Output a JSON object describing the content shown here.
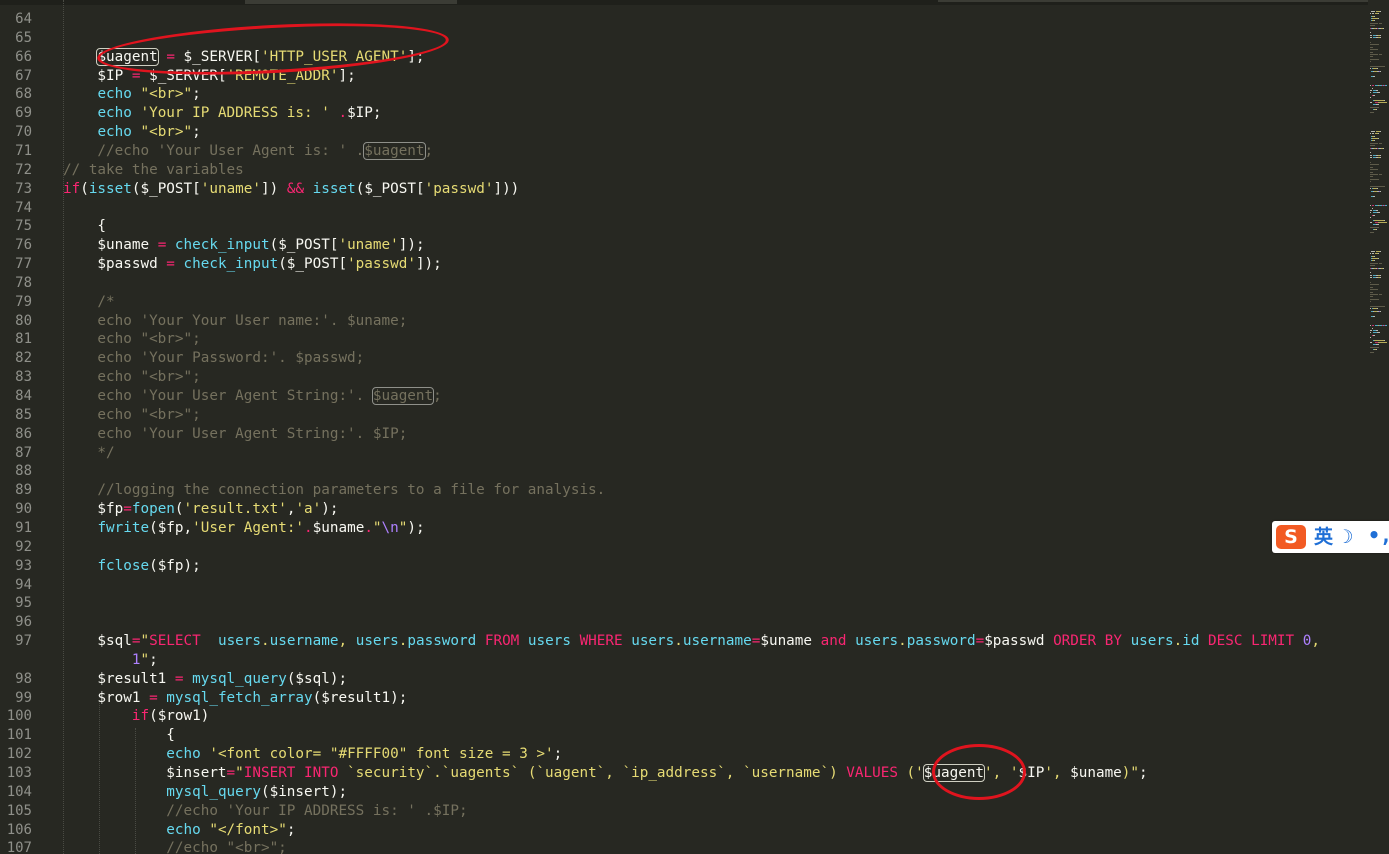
{
  "editor": {
    "theme": "monokai",
    "lines": [
      {
        "n": "64",
        "toks": []
      },
      {
        "n": "65",
        "toks": []
      },
      {
        "n": "66",
        "toks": [
          [
            "    ",
            "plain"
          ],
          [
            "$uagent",
            "hl"
          ],
          [
            " ",
            "plain"
          ],
          [
            "=",
            "kw"
          ],
          [
            " $_SERVER[",
            "plain"
          ],
          [
            "'HTTP_USER_AGENT'",
            "str"
          ],
          [
            "];",
            "plain"
          ]
        ]
      },
      {
        "n": "67",
        "toks": [
          [
            "    $IP ",
            "plain"
          ],
          [
            "=",
            "kw"
          ],
          [
            " $_SERVER[",
            "plain"
          ],
          [
            "'REMOTE_ADDR'",
            "str"
          ],
          [
            "];",
            "plain"
          ]
        ]
      },
      {
        "n": "68",
        "toks": [
          [
            "    ",
            "plain"
          ],
          [
            "echo",
            "fn"
          ],
          [
            " ",
            "plain"
          ],
          [
            "\"<br>\"",
            "str"
          ],
          [
            ";",
            "plain"
          ]
        ]
      },
      {
        "n": "69",
        "toks": [
          [
            "    ",
            "plain"
          ],
          [
            "echo",
            "fn"
          ],
          [
            " ",
            "plain"
          ],
          [
            "'Your IP ADDRESS is: '",
            "str"
          ],
          [
            " ",
            "plain"
          ],
          [
            ".",
            "kw"
          ],
          [
            "$IP;",
            "plain"
          ]
        ]
      },
      {
        "n": "70",
        "toks": [
          [
            "    ",
            "plain"
          ],
          [
            "echo",
            "fn"
          ],
          [
            " ",
            "plain"
          ],
          [
            "\"<br>\"",
            "str"
          ],
          [
            ";",
            "plain"
          ]
        ]
      },
      {
        "n": "71",
        "toks": [
          [
            "    //echo 'Your User Agent is: ' .",
            "cm"
          ],
          [
            "$uagent",
            "hlc"
          ],
          [
            ";",
            "cm"
          ]
        ]
      },
      {
        "n": "72",
        "toks": [
          [
            "// take the variables",
            "cm"
          ]
        ]
      },
      {
        "n": "73",
        "toks": [
          [
            "if",
            "kw"
          ],
          [
            "(",
            "plain"
          ],
          [
            "isset",
            "fn"
          ],
          [
            "($_POST[",
            "plain"
          ],
          [
            "'uname'",
            "str"
          ],
          [
            "]) ",
            "plain"
          ],
          [
            "&&",
            "kw"
          ],
          [
            " ",
            "plain"
          ],
          [
            "isset",
            "fn"
          ],
          [
            "($_POST[",
            "plain"
          ],
          [
            "'passwd'",
            "str"
          ],
          [
            "]))",
            "plain"
          ]
        ]
      },
      {
        "n": "74",
        "toks": []
      },
      {
        "n": "75",
        "toks": [
          [
            "    {",
            "plain"
          ]
        ]
      },
      {
        "n": "76",
        "toks": [
          [
            "    $uname ",
            "plain"
          ],
          [
            "=",
            "kw"
          ],
          [
            " ",
            "plain"
          ],
          [
            "check_input",
            "fn"
          ],
          [
            "($_POST[",
            "plain"
          ],
          [
            "'uname'",
            "str"
          ],
          [
            "]);",
            "plain"
          ]
        ]
      },
      {
        "n": "77",
        "toks": [
          [
            "    $passwd ",
            "plain"
          ],
          [
            "=",
            "kw"
          ],
          [
            " ",
            "plain"
          ],
          [
            "check_input",
            "fn"
          ],
          [
            "($_POST[",
            "plain"
          ],
          [
            "'passwd'",
            "str"
          ],
          [
            "]);",
            "plain"
          ]
        ]
      },
      {
        "n": "78",
        "toks": []
      },
      {
        "n": "79",
        "toks": [
          [
            "    /*",
            "cm"
          ]
        ]
      },
      {
        "n": "80",
        "toks": [
          [
            "    echo 'Your Your User name:'. $uname;",
            "cm"
          ]
        ]
      },
      {
        "n": "81",
        "toks": [
          [
            "    echo \"<br>\";",
            "cm"
          ]
        ]
      },
      {
        "n": "82",
        "toks": [
          [
            "    echo 'Your Password:'. $passwd;",
            "cm"
          ]
        ]
      },
      {
        "n": "83",
        "toks": [
          [
            "    echo \"<br>\";",
            "cm"
          ]
        ]
      },
      {
        "n": "84",
        "toks": [
          [
            "    echo 'Your User Agent String:'. ",
            "cm"
          ],
          [
            "$uagent",
            "hlc"
          ],
          [
            ";",
            "cm"
          ]
        ]
      },
      {
        "n": "85",
        "toks": [
          [
            "    echo \"<br>\";",
            "cm"
          ]
        ]
      },
      {
        "n": "86",
        "toks": [
          [
            "    echo 'Your User Agent String:'. $IP;",
            "cm"
          ]
        ]
      },
      {
        "n": "87",
        "toks": [
          [
            "    */",
            "cm"
          ]
        ]
      },
      {
        "n": "88",
        "toks": []
      },
      {
        "n": "89",
        "toks": [
          [
            "    //logging the connection parameters to a file for analysis.",
            "cm"
          ]
        ]
      },
      {
        "n": "90",
        "toks": [
          [
            "    $fp",
            "plain"
          ],
          [
            "=",
            "kw"
          ],
          [
            "fopen",
            "fn"
          ],
          [
            "(",
            "plain"
          ],
          [
            "'result.txt'",
            "str"
          ],
          [
            ",",
            "plain"
          ],
          [
            "'a'",
            "str"
          ],
          [
            ");",
            "plain"
          ]
        ]
      },
      {
        "n": "91",
        "toks": [
          [
            "    ",
            "plain"
          ],
          [
            "fwrite",
            "fn"
          ],
          [
            "($fp,",
            "plain"
          ],
          [
            "'User Agent:'",
            "str"
          ],
          [
            ".",
            "kw"
          ],
          [
            "$uname",
            "plain"
          ],
          [
            ".",
            "kw"
          ],
          [
            "\"",
            "str"
          ],
          [
            "\\n",
            "esc"
          ],
          [
            "\"",
            "str"
          ],
          [
            ");",
            "plain"
          ]
        ]
      },
      {
        "n": "92",
        "toks": []
      },
      {
        "n": "93",
        "toks": [
          [
            "    ",
            "plain"
          ],
          [
            "fclose",
            "fn"
          ],
          [
            "($fp);",
            "plain"
          ]
        ]
      },
      {
        "n": "94",
        "toks": []
      },
      {
        "n": "95",
        "toks": []
      },
      {
        "n": "96",
        "toks": []
      },
      {
        "n": "97",
        "toks": [
          [
            "    $sql",
            "plain"
          ],
          [
            "=",
            "kw"
          ],
          [
            "\"",
            "str"
          ],
          [
            "SELECT",
            "sqlkw"
          ],
          [
            "  ",
            "str"
          ],
          [
            "users",
            "sqlid"
          ],
          [
            ".",
            "str"
          ],
          [
            "username",
            "sqlid"
          ],
          [
            ", ",
            "str"
          ],
          [
            "users",
            "sqlid"
          ],
          [
            ".",
            "str"
          ],
          [
            "password",
            "sqlid"
          ],
          [
            " ",
            "str"
          ],
          [
            "FROM",
            "sqlkw"
          ],
          [
            " ",
            "str"
          ],
          [
            "users",
            "sqlid"
          ],
          [
            " ",
            "str"
          ],
          [
            "WHERE",
            "sqlkw"
          ],
          [
            " ",
            "str"
          ],
          [
            "users",
            "sqlid"
          ],
          [
            ".",
            "str"
          ],
          [
            "username",
            "sqlid"
          ],
          [
            "=",
            "kw"
          ],
          [
            "$uname",
            "plain"
          ],
          [
            " ",
            "str"
          ],
          [
            "and",
            "sqlkw"
          ],
          [
            " ",
            "str"
          ],
          [
            "users",
            "sqlid"
          ],
          [
            ".",
            "str"
          ],
          [
            "password",
            "sqlid"
          ],
          [
            "=",
            "kw"
          ],
          [
            "$passwd",
            "plain"
          ],
          [
            " ",
            "str"
          ],
          [
            "ORDER BY",
            "sqlkw"
          ],
          [
            " ",
            "str"
          ],
          [
            "users",
            "sqlid"
          ],
          [
            ".",
            "str"
          ],
          [
            "id",
            "sqlid"
          ],
          [
            " ",
            "str"
          ],
          [
            "DESC LIMIT",
            "sqlkw"
          ],
          [
            " ",
            "str"
          ],
          [
            "0",
            "num"
          ],
          [
            ",",
            "str"
          ]
        ]
      },
      {
        "n": "",
        "toks": [
          [
            "        ",
            "plain"
          ],
          [
            "1",
            "num"
          ],
          [
            "\"",
            "str"
          ],
          [
            ";",
            "plain"
          ]
        ]
      },
      {
        "n": "98",
        "toks": [
          [
            "    $result1 ",
            "plain"
          ],
          [
            "=",
            "kw"
          ],
          [
            " ",
            "plain"
          ],
          [
            "mysql_query",
            "fn"
          ],
          [
            "($sql);",
            "plain"
          ]
        ]
      },
      {
        "n": "99",
        "toks": [
          [
            "    $row1 ",
            "plain"
          ],
          [
            "=",
            "kw"
          ],
          [
            " ",
            "plain"
          ],
          [
            "mysql_fetch_array",
            "fn"
          ],
          [
            "($result1);",
            "plain"
          ]
        ]
      },
      {
        "n": "100",
        "toks": [
          [
            "        ",
            "plain"
          ],
          [
            "if",
            "kw"
          ],
          [
            "($row1)",
            "plain"
          ]
        ]
      },
      {
        "n": "101",
        "toks": [
          [
            "            {",
            "plain"
          ]
        ]
      },
      {
        "n": "102",
        "toks": [
          [
            "            ",
            "plain"
          ],
          [
            "echo",
            "fn"
          ],
          [
            " ",
            "plain"
          ],
          [
            "'<font color= \"#FFFF00\" font size = 3 >'",
            "str"
          ],
          [
            ";",
            "plain"
          ]
        ]
      },
      {
        "n": "103",
        "toks": [
          [
            "            $insert",
            "plain"
          ],
          [
            "=",
            "kw"
          ],
          [
            "\"",
            "str"
          ],
          [
            "INSERT INTO",
            "sqlkw"
          ],
          [
            " `security`.`uagents` (`uagent`, `ip_address`, `username`) ",
            "str"
          ],
          [
            "VALUES",
            "sqlkw"
          ],
          [
            " ('",
            "str"
          ],
          [
            "$uagent",
            "hl"
          ],
          [
            "', '",
            "str"
          ],
          [
            "$IP",
            "plain"
          ],
          [
            "', ",
            "str"
          ],
          [
            "$uname",
            "plain"
          ],
          [
            ")\"",
            "str"
          ],
          [
            ";",
            "plain"
          ]
        ]
      },
      {
        "n": "104",
        "toks": [
          [
            "            ",
            "plain"
          ],
          [
            "mysql_query",
            "fn"
          ],
          [
            "($insert);",
            "plain"
          ]
        ]
      },
      {
        "n": "105",
        "toks": [
          [
            "            //echo 'Your IP ADDRESS is: ' .$IP;",
            "cm"
          ]
        ]
      },
      {
        "n": "106",
        "toks": [
          [
            "            ",
            "plain"
          ],
          [
            "echo",
            "fn"
          ],
          [
            " ",
            "plain"
          ],
          [
            "\"</font>\"",
            "str"
          ],
          [
            ";",
            "plain"
          ]
        ]
      },
      {
        "n": "107",
        "toks": [
          [
            "            //echo \"<br>\";",
            "cm"
          ]
        ]
      }
    ]
  },
  "ime": {
    "logo": "S",
    "lang": "英",
    "moon": "☽",
    "punct": "•,"
  },
  "colors": {
    "background": "#272822",
    "annotation": "#e0141e"
  }
}
